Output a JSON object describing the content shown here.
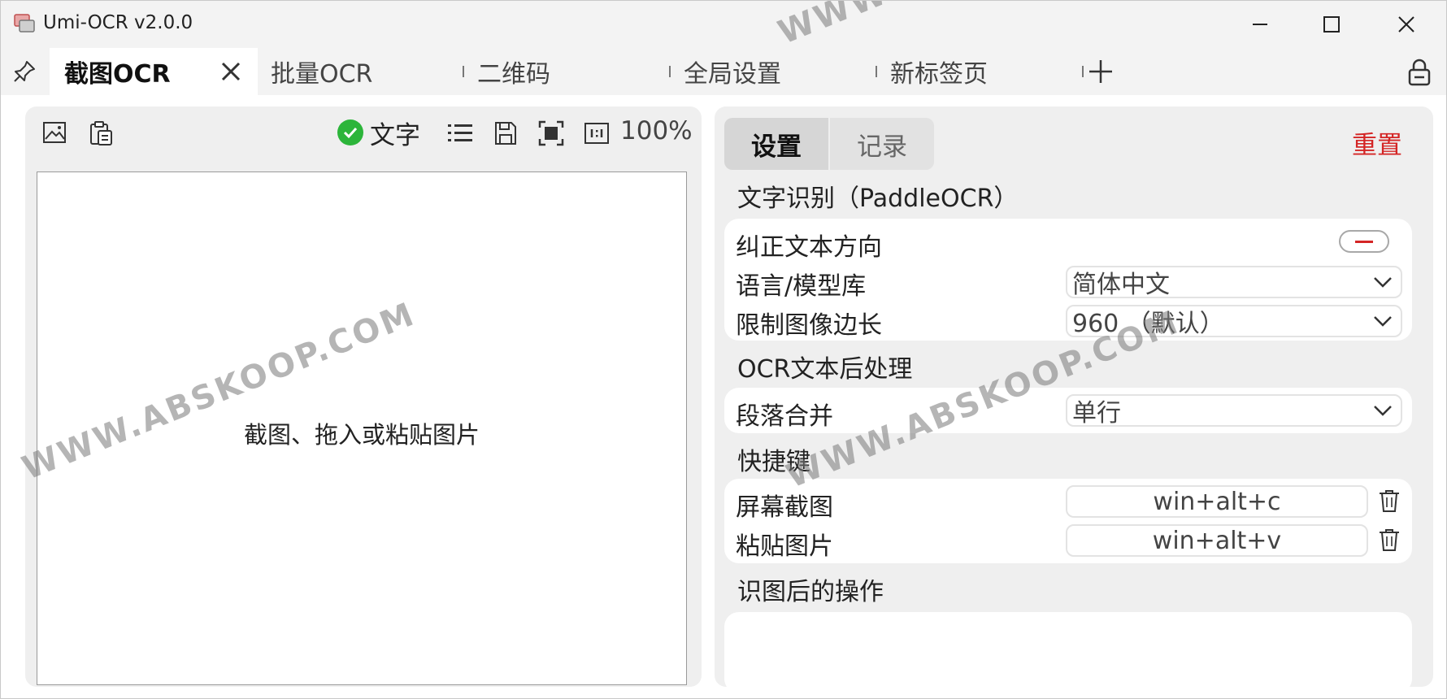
{
  "window": {
    "title": "Umi-OCR v2.0.0"
  },
  "tabs": [
    {
      "label": "截图OCR",
      "active": true
    },
    {
      "label": "批量OCR",
      "active": false
    },
    {
      "label": "二维码",
      "active": false
    },
    {
      "label": "全局设置",
      "active": false
    },
    {
      "label": "新标签页",
      "active": false
    }
  ],
  "left": {
    "toolbar": {
      "text_toggle_label": "文字",
      "zoom": "100%"
    },
    "hint": "截图、拖入或粘贴图片"
  },
  "right": {
    "seg_settings": "设置",
    "seg_records": "记录",
    "reset": "重置",
    "sections": {
      "ocr_title": "文字识别（PaddleOCR）",
      "correct_direction": "纠正文本方向",
      "language_label": "语言/模型库",
      "language_value": "简体中文",
      "limit_label": "限制图像边长",
      "limit_value": "960 （默认）",
      "post_title": "OCR文本后处理",
      "merge_label": "段落合并",
      "merge_value": "单行",
      "hotkey_title": "快捷键",
      "screenshot_label": "屏幕截图",
      "screenshot_value": "win+alt+c",
      "paste_label": "粘贴图片",
      "paste_value": "win+alt+v",
      "after_title": "识图后的操作"
    }
  },
  "watermark": "WWW.ABSKOOP.COM",
  "colors": {
    "accent_red": "#d42525",
    "check_green": "#2cb53a",
    "panel_bg": "#efefef"
  }
}
